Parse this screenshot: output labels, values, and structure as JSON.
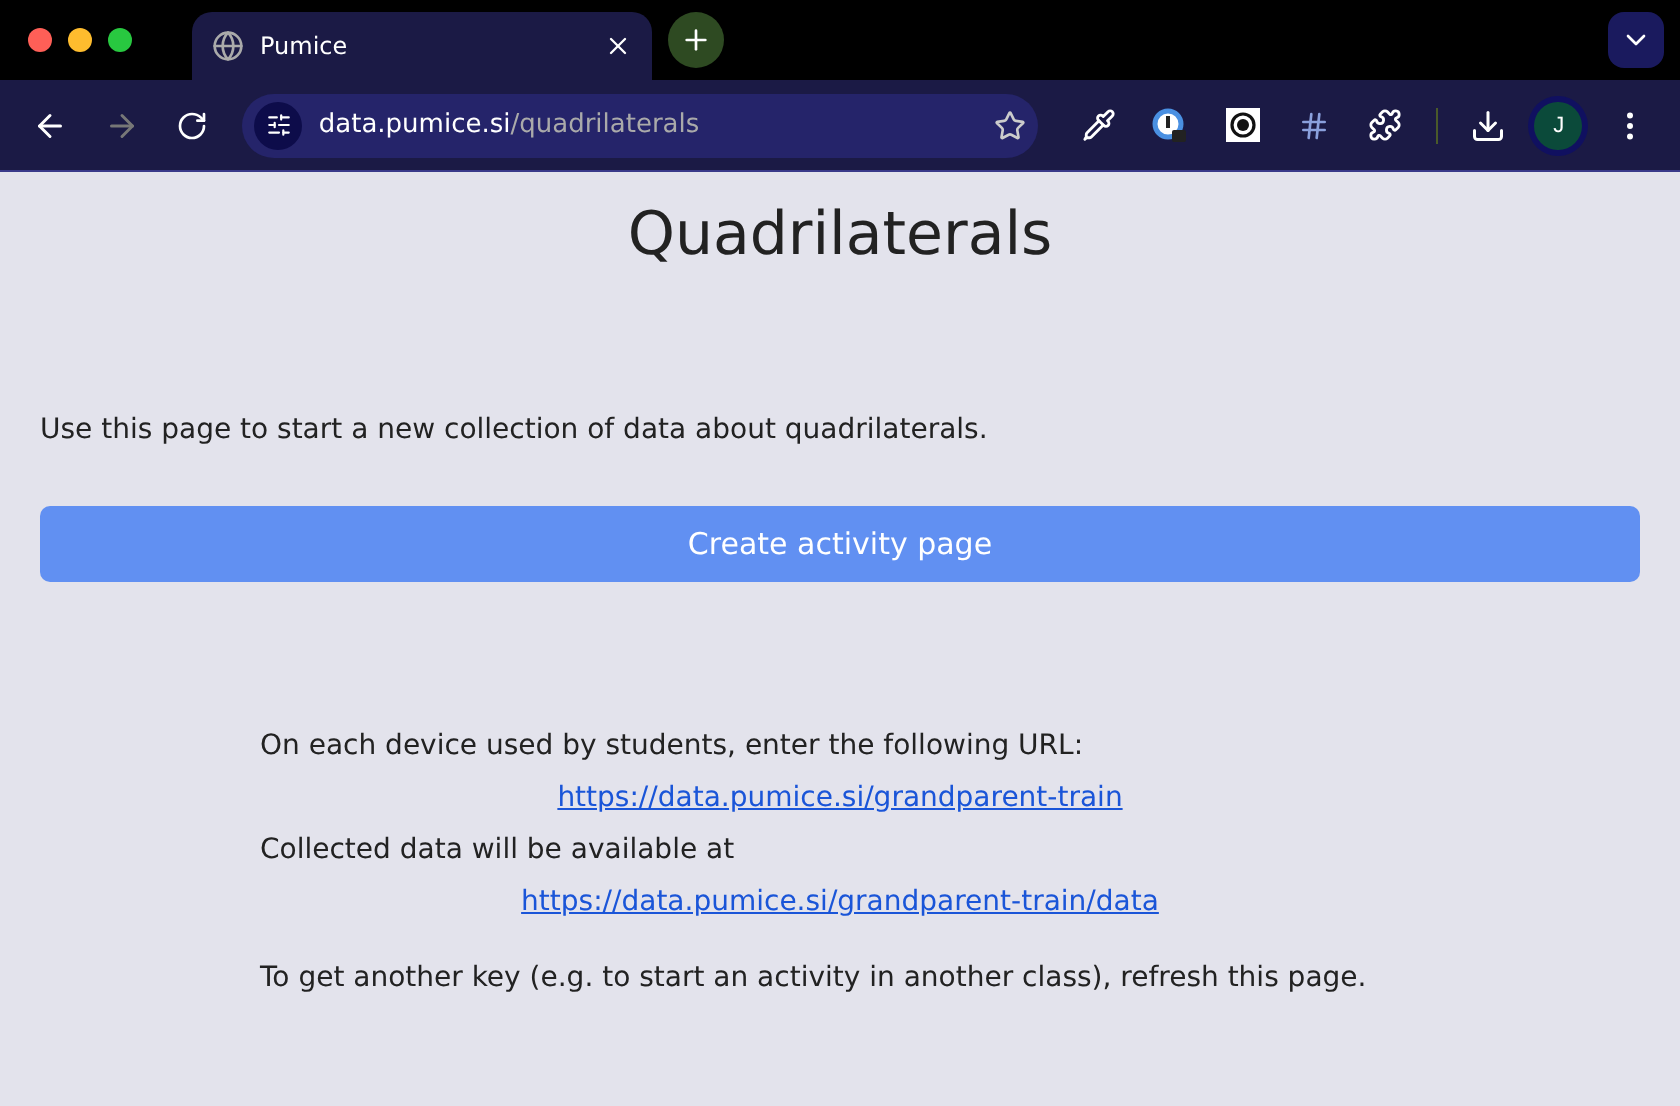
{
  "browser": {
    "tabs": [
      {
        "title": "Pumice",
        "selected": true
      }
    ],
    "address": {
      "host": "data.pumice.si",
      "path": "/quadrilaterals"
    },
    "profile": {
      "initial": "J"
    }
  },
  "page": {
    "title": "Quadrilaterals",
    "intro": "Use this page to start a new collection of data about quadrilaterals.",
    "create_button": "Create activity page",
    "instructions": [
      {
        "kind": "text",
        "text": "On each device used by students, enter the following URL:"
      },
      {
        "kind": "link",
        "text": "https://data.pumice.si/grandparent-train"
      },
      {
        "kind": "text",
        "text": "Collected data will be available at"
      },
      {
        "kind": "link",
        "text": "https://data.pumice.si/grandparent-train/data"
      },
      {
        "kind": "note",
        "text": "To get another key (e.g. to start an activity in another class), refresh this page."
      }
    ]
  }
}
